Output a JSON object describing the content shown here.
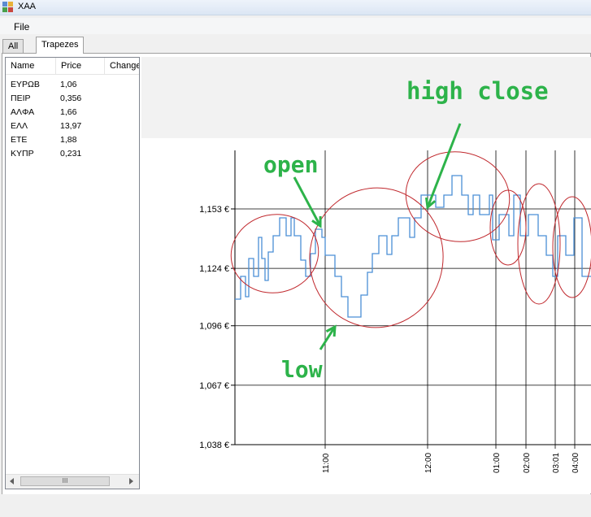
{
  "window": {
    "title": "XAA"
  },
  "menu": {
    "file": "File"
  },
  "tabs": [
    {
      "label": "All"
    },
    {
      "label": "Trapezes"
    }
  ],
  "stocks": {
    "columns": [
      "Name",
      "Price",
      "Change"
    ],
    "rows": [
      {
        "name": "ΕΥΡΩΒ",
        "price": "1,06"
      },
      {
        "name": "ΠΕΙΡ",
        "price": "0,356"
      },
      {
        "name": "ΑΛΦΑ",
        "price": "1,66"
      },
      {
        "name": "ΕΛΛ",
        "price": "13,97"
      },
      {
        "name": "ΕΤΕ",
        "price": "1,88"
      },
      {
        "name": "ΚΥΠΡ",
        "price": "0,231"
      }
    ]
  },
  "chart_data": {
    "type": "line",
    "y_ticks": [
      "1,153 €",
      "1,124 €",
      "1,096 €",
      "1,067 €",
      "1,038 €"
    ],
    "y_tick_values": [
      1.153,
      1.124,
      1.096,
      1.067,
      1.038
    ],
    "x_ticks": [
      "11:00",
      "12:00",
      "01:00",
      "02:00",
      "03:01",
      "04:00"
    ],
    "series_color": "#4a8fd6",
    "annotation_color": "#2db34a",
    "circle_color": "#c0282d",
    "annotations": [
      "open",
      "high close",
      "low"
    ]
  }
}
